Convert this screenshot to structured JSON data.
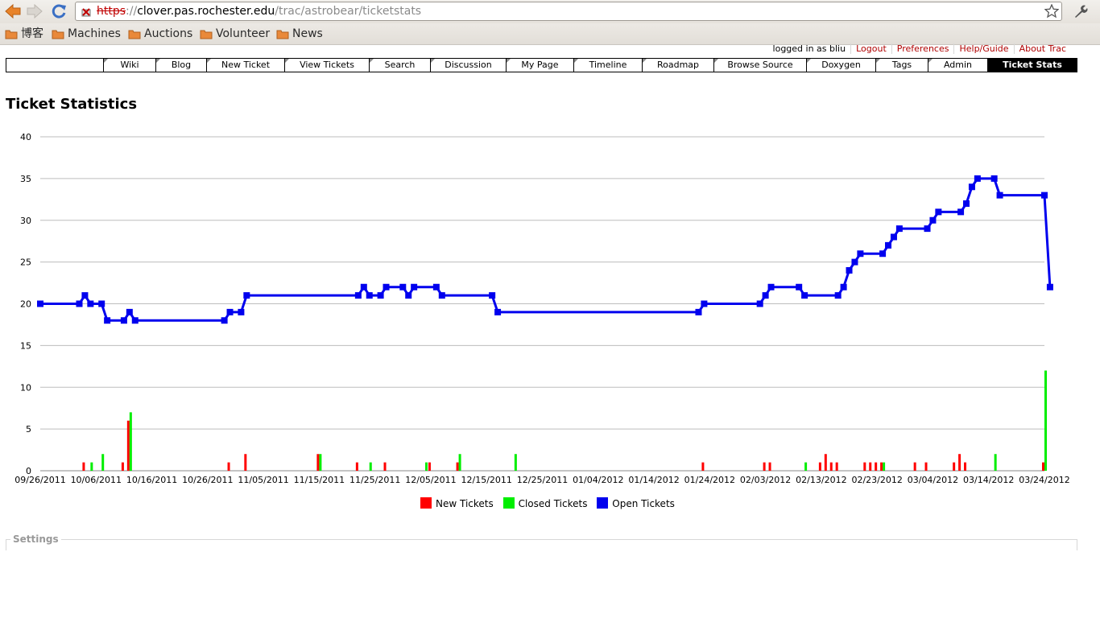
{
  "browser": {
    "url": {
      "protocol": "https",
      "host": "clover.pas.rochester.edu",
      "path": "/trac/astrobear/ticketstats"
    }
  },
  "bookmarks": [
    {
      "label": "博客"
    },
    {
      "label": "Machines"
    },
    {
      "label": "Auctions"
    },
    {
      "label": "Volunteer"
    },
    {
      "label": "News"
    }
  ],
  "meta_nav": {
    "logged_in": "logged in as bliu",
    "links": [
      "Logout",
      "Preferences",
      "Help/Guide",
      "About Trac"
    ]
  },
  "main_nav": {
    "tabs": [
      "Wiki",
      "Blog",
      "New Ticket",
      "View Tickets",
      "Search",
      "Discussion",
      "My Page",
      "Timeline",
      "Roadmap",
      "Browse Source",
      "Doxygen",
      "Tags",
      "Admin",
      "Ticket Stats"
    ],
    "active": "Ticket Stats"
  },
  "page": {
    "title": "Ticket Statistics",
    "settings_label": "Settings"
  },
  "colors": {
    "new": "#ff0000",
    "closed": "#00ee00",
    "open": "#0000ee",
    "link": "#b00000"
  },
  "chart_data": {
    "type": "line",
    "ylim": [
      0,
      40
    ],
    "yticks": [
      0,
      5,
      10,
      15,
      20,
      25,
      30,
      35,
      40
    ],
    "xlim": [
      "2011-09-26",
      "2012-03-24"
    ],
    "xticks": [
      "09/26/2011",
      "10/06/2011",
      "10/16/2011",
      "10/26/2011",
      "11/05/2011",
      "11/15/2011",
      "11/25/2011",
      "12/05/2011",
      "12/15/2011",
      "12/25/2011",
      "01/04/2012",
      "01/14/2012",
      "01/24/2012",
      "02/03/2012",
      "02/13/2012",
      "02/23/2012",
      "03/04/2012",
      "03/14/2012",
      "03/24/2012"
    ],
    "grid": true,
    "legend": "bottom",
    "series": [
      {
        "name": "New Tickets",
        "type": "bar",
        "points": [
          [
            "2011-10-04",
            1
          ],
          [
            "2011-10-11",
            1
          ],
          [
            "2011-10-12",
            6
          ],
          [
            "2011-10-30",
            1
          ],
          [
            "2011-11-02",
            2
          ],
          [
            "2011-11-15",
            2
          ],
          [
            "2011-11-22",
            1
          ],
          [
            "2011-11-27",
            1
          ],
          [
            "2011-12-05",
            1
          ],
          [
            "2011-12-10",
            1
          ],
          [
            "2012-01-23",
            1
          ],
          [
            "2012-02-03",
            1
          ],
          [
            "2012-02-04",
            1
          ],
          [
            "2012-02-13",
            1
          ],
          [
            "2012-02-14",
            2
          ],
          [
            "2012-02-15",
            1
          ],
          [
            "2012-02-16",
            1
          ],
          [
            "2012-02-21",
            1
          ],
          [
            "2012-02-22",
            1
          ],
          [
            "2012-02-23",
            1
          ],
          [
            "2012-02-24",
            1
          ],
          [
            "2012-03-01",
            1
          ],
          [
            "2012-03-03",
            1
          ],
          [
            "2012-03-08",
            1
          ],
          [
            "2012-03-09",
            2
          ],
          [
            "2012-03-10",
            1
          ],
          [
            "2012-03-24",
            1
          ]
        ]
      },
      {
        "name": "Closed Tickets",
        "type": "bar",
        "points": [
          [
            "2011-10-05",
            1
          ],
          [
            "2011-10-07",
            2
          ],
          [
            "2011-10-12",
            7
          ],
          [
            "2011-11-15",
            2
          ],
          [
            "2011-11-24",
            1
          ],
          [
            "2011-12-04",
            1
          ],
          [
            "2011-12-10",
            2
          ],
          [
            "2011-12-20",
            2
          ],
          [
            "2012-02-10",
            1
          ],
          [
            "2012-02-24",
            1
          ],
          [
            "2012-03-15",
            2
          ],
          [
            "2012-03-24",
            12
          ]
        ]
      },
      {
        "name": "Open Tickets",
        "type": "line",
        "points": [
          [
            "2011-09-26",
            20
          ],
          [
            "2011-10-03",
            20
          ],
          [
            "2011-10-04",
            21
          ],
          [
            "2011-10-05",
            20
          ],
          [
            "2011-10-07",
            20
          ],
          [
            "2011-10-08",
            18
          ],
          [
            "2011-10-11",
            18
          ],
          [
            "2011-10-12",
            19
          ],
          [
            "2011-10-13",
            18
          ],
          [
            "2011-10-29",
            18
          ],
          [
            "2011-10-30",
            19
          ],
          [
            "2011-11-01",
            19
          ],
          [
            "2011-11-02",
            21
          ],
          [
            "2011-11-22",
            21
          ],
          [
            "2011-11-23",
            22
          ],
          [
            "2011-11-24",
            21
          ],
          [
            "2011-11-26",
            21
          ],
          [
            "2011-11-27",
            22
          ],
          [
            "2011-11-30",
            22
          ],
          [
            "2011-12-01",
            21
          ],
          [
            "2011-12-02",
            22
          ],
          [
            "2011-12-06",
            22
          ],
          [
            "2011-12-07",
            21
          ],
          [
            "2011-12-16",
            21
          ],
          [
            "2011-12-17",
            19
          ],
          [
            "2012-01-22",
            19
          ],
          [
            "2012-01-23",
            20
          ],
          [
            "2012-02-02",
            20
          ],
          [
            "2012-02-03",
            21
          ],
          [
            "2012-02-04",
            22
          ],
          [
            "2012-02-09",
            22
          ],
          [
            "2012-02-10",
            21
          ],
          [
            "2012-02-16",
            21
          ],
          [
            "2012-02-17",
            22
          ],
          [
            "2012-02-18",
            24
          ],
          [
            "2012-02-19",
            25
          ],
          [
            "2012-02-20",
            26
          ],
          [
            "2012-02-24",
            26
          ],
          [
            "2012-02-25",
            27
          ],
          [
            "2012-02-26",
            28
          ],
          [
            "2012-02-27",
            29
          ],
          [
            "2012-03-03",
            29
          ],
          [
            "2012-03-04",
            30
          ],
          [
            "2012-03-05",
            31
          ],
          [
            "2012-03-09",
            31
          ],
          [
            "2012-03-10",
            32
          ],
          [
            "2012-03-11",
            34
          ],
          [
            "2012-03-12",
            35
          ],
          [
            "2012-03-15",
            35
          ],
          [
            "2012-03-16",
            33
          ],
          [
            "2012-03-24",
            33
          ],
          [
            "2012-03-25",
            22
          ]
        ]
      }
    ]
  }
}
